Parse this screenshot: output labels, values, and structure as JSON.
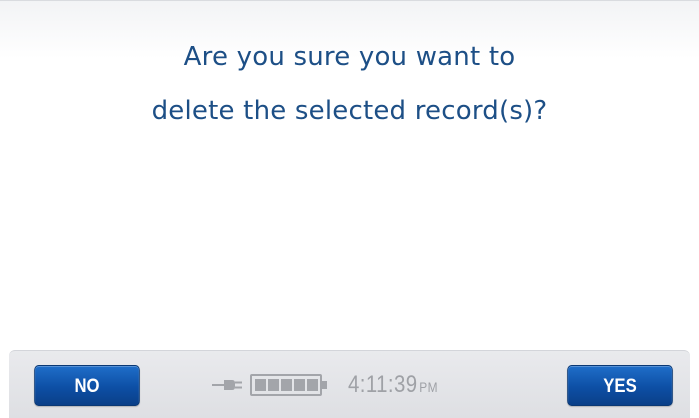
{
  "dialog": {
    "message_line1": "Are you sure you want to",
    "message_line2": "delete the selected record(s)?"
  },
  "footer": {
    "no_label": "NO",
    "yes_label": "YES",
    "time": "4:11:39",
    "ampm": "PM",
    "power_icon": "plug-icon",
    "battery_icon": "battery-icon",
    "battery_level": 1.0
  },
  "colors": {
    "message_text": "#1d4f86",
    "button_blue": "#0d4fa5",
    "status_gray": "#9fa1a6"
  }
}
